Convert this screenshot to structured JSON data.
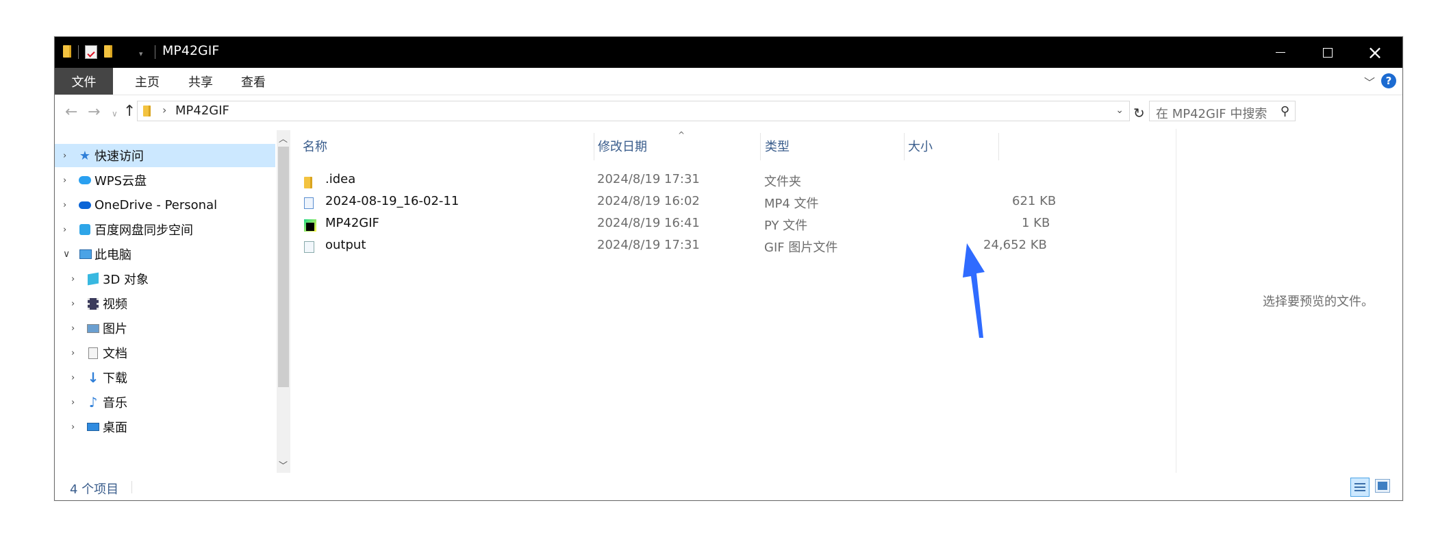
{
  "window": {
    "title": "MP42GIF",
    "controls": {
      "minimize": "—",
      "maximize": "☐",
      "close": "✕"
    }
  },
  "ribbon": {
    "tabs": [
      "文件",
      "主页",
      "共享",
      "查看"
    ],
    "help_label": "?"
  },
  "address": {
    "path_segment": "MP42GIF",
    "search_placeholder": "在 MP42GIF 中搜索"
  },
  "sidebar": {
    "items": [
      {
        "label": "快速访问",
        "icon": "star-pin-icon",
        "selected": true
      },
      {
        "label": "WPS云盘",
        "icon": "wps-cloud-icon"
      },
      {
        "label": "OneDrive - Personal",
        "icon": "onedrive-icon"
      },
      {
        "label": "百度网盘同步空间",
        "icon": "baidu-netdisk-icon"
      },
      {
        "label": "此电脑",
        "icon": "this-pc-icon",
        "expanded": true
      },
      {
        "label": "3D 对象",
        "icon": "3d-objects-icon"
      },
      {
        "label": "视频",
        "icon": "videos-icon"
      },
      {
        "label": "图片",
        "icon": "pictures-icon"
      },
      {
        "label": "文档",
        "icon": "documents-icon"
      },
      {
        "label": "下载",
        "icon": "downloads-icon"
      },
      {
        "label": "音乐",
        "icon": "music-icon"
      },
      {
        "label": "桌面",
        "icon": "desktop-icon"
      }
    ]
  },
  "columns": {
    "name": "名称",
    "date": "修改日期",
    "type": "类型",
    "size": "大小"
  },
  "files": [
    {
      "name": ".idea",
      "date": "2024/8/19 17:31",
      "type": "文件夹",
      "size": "",
      "icon": "folder-icon"
    },
    {
      "name": "2024-08-19_16-02-11",
      "date": "2024/8/19 16:02",
      "type": "MP4 文件",
      "size": "621 KB",
      "icon": "mp4-file-icon"
    },
    {
      "name": "MP42GIF",
      "date": "2024/8/19 16:41",
      "type": "PY 文件",
      "size": "1 KB",
      "icon": "pycharm-file-icon"
    },
    {
      "name": "output",
      "date": "2024/8/19 17:31",
      "type": "GIF 图片文件",
      "size": "24,652 KB",
      "icon": "gif-file-icon"
    }
  ],
  "preview": {
    "text": "选择要预览的文件。"
  },
  "status": {
    "item_count": "4 个项目"
  },
  "colors": {
    "accent_blue": "#2f6bff",
    "selection": "#cce8ff",
    "titlebar": "#000000"
  }
}
